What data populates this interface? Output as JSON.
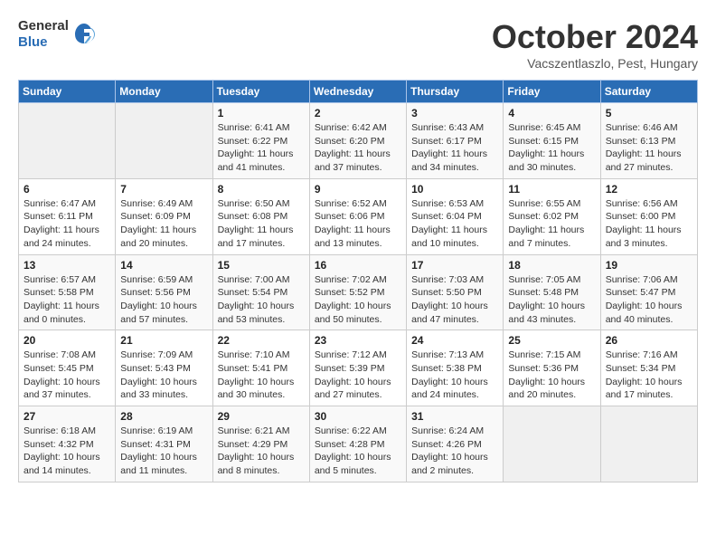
{
  "header": {
    "logo": {
      "line1": "General",
      "line2": "Blue"
    },
    "title": "October 2024",
    "subtitle": "Vacszentlaszlo, Pest, Hungary"
  },
  "days_of_week": [
    "Sunday",
    "Monday",
    "Tuesday",
    "Wednesday",
    "Thursday",
    "Friday",
    "Saturday"
  ],
  "weeks": [
    [
      {
        "day": "",
        "info": ""
      },
      {
        "day": "",
        "info": ""
      },
      {
        "day": "1",
        "info": "Sunrise: 6:41 AM\nSunset: 6:22 PM\nDaylight: 11 hours and 41 minutes."
      },
      {
        "day": "2",
        "info": "Sunrise: 6:42 AM\nSunset: 6:20 PM\nDaylight: 11 hours and 37 minutes."
      },
      {
        "day": "3",
        "info": "Sunrise: 6:43 AM\nSunset: 6:17 PM\nDaylight: 11 hours and 34 minutes."
      },
      {
        "day": "4",
        "info": "Sunrise: 6:45 AM\nSunset: 6:15 PM\nDaylight: 11 hours and 30 minutes."
      },
      {
        "day": "5",
        "info": "Sunrise: 6:46 AM\nSunset: 6:13 PM\nDaylight: 11 hours and 27 minutes."
      }
    ],
    [
      {
        "day": "6",
        "info": "Sunrise: 6:47 AM\nSunset: 6:11 PM\nDaylight: 11 hours and 24 minutes."
      },
      {
        "day": "7",
        "info": "Sunrise: 6:49 AM\nSunset: 6:09 PM\nDaylight: 11 hours and 20 minutes."
      },
      {
        "day": "8",
        "info": "Sunrise: 6:50 AM\nSunset: 6:08 PM\nDaylight: 11 hours and 17 minutes."
      },
      {
        "day": "9",
        "info": "Sunrise: 6:52 AM\nSunset: 6:06 PM\nDaylight: 11 hours and 13 minutes."
      },
      {
        "day": "10",
        "info": "Sunrise: 6:53 AM\nSunset: 6:04 PM\nDaylight: 11 hours and 10 minutes."
      },
      {
        "day": "11",
        "info": "Sunrise: 6:55 AM\nSunset: 6:02 PM\nDaylight: 11 hours and 7 minutes."
      },
      {
        "day": "12",
        "info": "Sunrise: 6:56 AM\nSunset: 6:00 PM\nDaylight: 11 hours and 3 minutes."
      }
    ],
    [
      {
        "day": "13",
        "info": "Sunrise: 6:57 AM\nSunset: 5:58 PM\nDaylight: 11 hours and 0 minutes."
      },
      {
        "day": "14",
        "info": "Sunrise: 6:59 AM\nSunset: 5:56 PM\nDaylight: 10 hours and 57 minutes."
      },
      {
        "day": "15",
        "info": "Sunrise: 7:00 AM\nSunset: 5:54 PM\nDaylight: 10 hours and 53 minutes."
      },
      {
        "day": "16",
        "info": "Sunrise: 7:02 AM\nSunset: 5:52 PM\nDaylight: 10 hours and 50 minutes."
      },
      {
        "day": "17",
        "info": "Sunrise: 7:03 AM\nSunset: 5:50 PM\nDaylight: 10 hours and 47 minutes."
      },
      {
        "day": "18",
        "info": "Sunrise: 7:05 AM\nSunset: 5:48 PM\nDaylight: 10 hours and 43 minutes."
      },
      {
        "day": "19",
        "info": "Sunrise: 7:06 AM\nSunset: 5:47 PM\nDaylight: 10 hours and 40 minutes."
      }
    ],
    [
      {
        "day": "20",
        "info": "Sunrise: 7:08 AM\nSunset: 5:45 PM\nDaylight: 10 hours and 37 minutes."
      },
      {
        "day": "21",
        "info": "Sunrise: 7:09 AM\nSunset: 5:43 PM\nDaylight: 10 hours and 33 minutes."
      },
      {
        "day": "22",
        "info": "Sunrise: 7:10 AM\nSunset: 5:41 PM\nDaylight: 10 hours and 30 minutes."
      },
      {
        "day": "23",
        "info": "Sunrise: 7:12 AM\nSunset: 5:39 PM\nDaylight: 10 hours and 27 minutes."
      },
      {
        "day": "24",
        "info": "Sunrise: 7:13 AM\nSunset: 5:38 PM\nDaylight: 10 hours and 24 minutes."
      },
      {
        "day": "25",
        "info": "Sunrise: 7:15 AM\nSunset: 5:36 PM\nDaylight: 10 hours and 20 minutes."
      },
      {
        "day": "26",
        "info": "Sunrise: 7:16 AM\nSunset: 5:34 PM\nDaylight: 10 hours and 17 minutes."
      }
    ],
    [
      {
        "day": "27",
        "info": "Sunrise: 6:18 AM\nSunset: 4:32 PM\nDaylight: 10 hours and 14 minutes."
      },
      {
        "day": "28",
        "info": "Sunrise: 6:19 AM\nSunset: 4:31 PM\nDaylight: 10 hours and 11 minutes."
      },
      {
        "day": "29",
        "info": "Sunrise: 6:21 AM\nSunset: 4:29 PM\nDaylight: 10 hours and 8 minutes."
      },
      {
        "day": "30",
        "info": "Sunrise: 6:22 AM\nSunset: 4:28 PM\nDaylight: 10 hours and 5 minutes."
      },
      {
        "day": "31",
        "info": "Sunrise: 6:24 AM\nSunset: 4:26 PM\nDaylight: 10 hours and 2 minutes."
      },
      {
        "day": "",
        "info": ""
      },
      {
        "day": "",
        "info": ""
      }
    ]
  ]
}
